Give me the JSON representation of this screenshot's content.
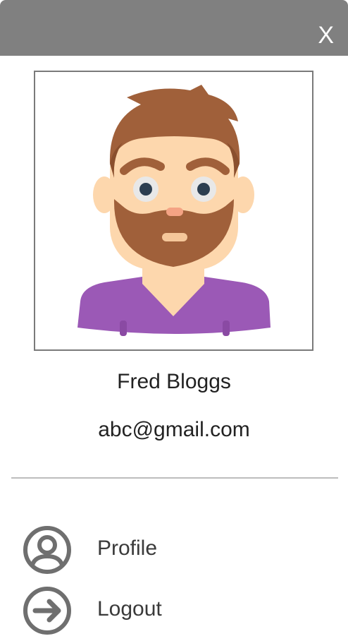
{
  "header": {
    "close_label": "X"
  },
  "user": {
    "name": "Fred Bloggs",
    "email": "abc@gmail.com"
  },
  "menu": {
    "items": [
      {
        "label": "Profile",
        "icon": "user-circle-icon"
      },
      {
        "label": "Logout",
        "icon": "arrow-right-circle-icon"
      }
    ]
  },
  "colors": {
    "header_bg": "#808080",
    "icon_gray": "#6f6f6f",
    "shirt": "#9b59b6",
    "hair": "#a0603a",
    "skin": "#fdd7ad"
  }
}
